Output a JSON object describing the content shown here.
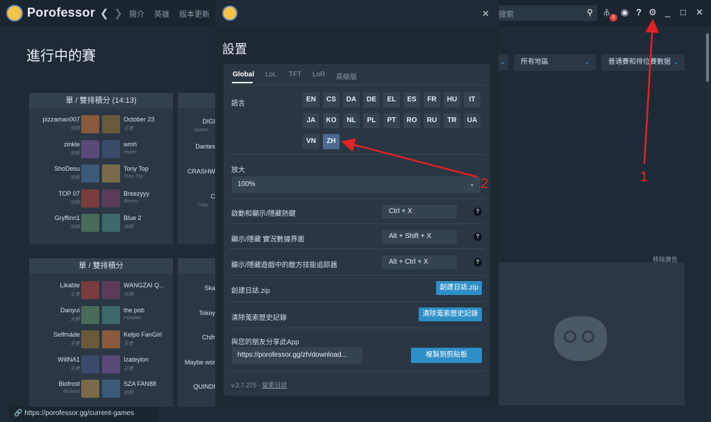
{
  "app": {
    "name": "Porofessor"
  },
  "topbar": {
    "nav": [
      "簡介",
      "英雄",
      "版本更新"
    ],
    "search_placeholder": "搜索"
  },
  "page": {
    "title": "進行中的賽",
    "panel1_title": "單 / 雙排積分 (14:13)",
    "panel2_title": "單 / 雙排積分",
    "filters": [
      "所有地區",
      "普通賽和排位賽數据"
    ],
    "ad_label": "移除廣告",
    "status_url": "https://porofessor.gg/current-games"
  },
  "games_top": [
    {
      "left": "pizzaman007",
      "left_rank": "宗師",
      "right": "October 23",
      "right_rank": "王者"
    },
    {
      "left": "zinkle",
      "left_rank": "宗師",
      "right": "wmh",
      "right_rank": "Hyper"
    },
    {
      "left": "ShoDesu",
      "left_rank": "宗師",
      "right": "Tony Top",
      "right_rank": "Tony Top"
    },
    {
      "left": "TOP 07",
      "left_rank": "宗師",
      "right": "Breezyyy",
      "right_rank": "Breezy"
    },
    {
      "left": "Gryffinn1",
      "left_rank": "宗師",
      "right": "Blue 2",
      "right_rank": "宗師"
    }
  ],
  "games_bottom": [
    {
      "left": "Likable",
      "left_rank": "王者",
      "right": "WANGZAI Q...",
      "right_rank": "大師"
    },
    {
      "left": "Danyui",
      "left_rank": "大師",
      "right": "the pob",
      "right_rank": "Pobelter"
    },
    {
      "left": "Selfmáde",
      "left_rank": "王者",
      "right": "Kelpo FanGirl",
      "right_rank": "王者"
    },
    {
      "left": "WillNA1",
      "left_rank": "王者",
      "right": "Izateylon",
      "right_rank": "王者"
    },
    {
      "left": "Biofrost",
      "left_rank": "Biofrost",
      "right": "SZA FAN88",
      "right_rank": "宗師"
    }
  ],
  "games_mid": [
    {
      "name": "DIGI",
      "rank": "Spawn"
    },
    {
      "name": "Dantes",
      "rank": ""
    },
    {
      "name": "CRASHW",
      "rank": ""
    },
    {
      "name": "C",
      "rank": "Copy"
    }
  ],
  "games_mid2": [
    "Ska",
    "Tokoy",
    "Chifr",
    "Maybe wor",
    "QUINDI"
  ],
  "settings": {
    "title": "設置",
    "tabs": [
      "Global",
      "LoL",
      "TFT",
      "LoR",
      "高級版"
    ],
    "language_label": "語言",
    "languages": [
      "EN",
      "CS",
      "DA",
      "DE",
      "EL",
      "ES",
      "FR",
      "HU",
      "IT",
      "JA",
      "KO",
      "NL",
      "PL",
      "PT",
      "RO",
      "RU",
      "TR",
      "UA",
      "VN",
      "ZH"
    ],
    "selected_language": "ZH",
    "zoom_label": "放大",
    "zoom_value": "100%",
    "hotkeys": [
      {
        "label": "啟動和顯示/隱藏熱鍵",
        "value": "Ctrl + X"
      },
      {
        "label": "顯示/隱藏 實況數據界面",
        "value": "Alt + Shift + X"
      },
      {
        "label": "顯示/隱藏遊戲中的敵方技能追踪器",
        "value": "Alt + Ctrl + X"
      }
    ],
    "log_label": "創建日誌.zip",
    "log_button": "創建日誌.zip",
    "history_label": "清除蒐索歷史記錄",
    "history_button": "清除蒐索歷史記錄",
    "share_label": "與您的朋友分享此App",
    "share_url": "https://porofessor.gg/zh/download...",
    "copy_button": "複製到剪貼板",
    "version": "v.2.7.275 - ",
    "changelog": "變更日誌"
  },
  "annotations": {
    "one": "1",
    "two": "2"
  },
  "colors": {
    "accent": "#2e8fc7",
    "annotation": "#e22222",
    "modal_bg": "#1e2833"
  }
}
